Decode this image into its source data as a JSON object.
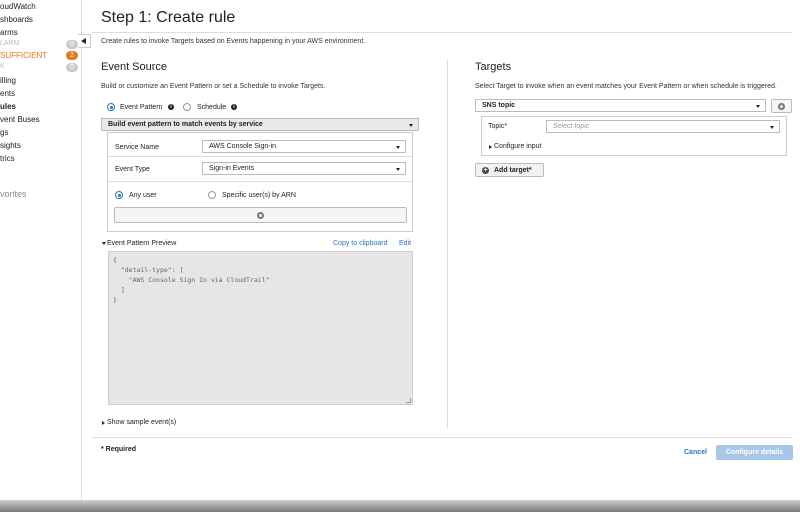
{
  "sidebar": {
    "items": [
      {
        "label": "oudWatch",
        "style": "normal"
      },
      {
        "label": "shboards",
        "style": "normal"
      },
      {
        "label": "arms",
        "style": "normal"
      },
      {
        "label": "LARM",
        "style": "grey",
        "badge": "0"
      },
      {
        "label": "SUFFICIENT",
        "style": "orange",
        "badge": "2"
      },
      {
        "label": "K",
        "style": "grey",
        "badge": "0"
      },
      {
        "label": "illing",
        "style": "normal"
      },
      {
        "label": "ents",
        "style": "normal"
      },
      {
        "label": "ules",
        "style": "bold"
      },
      {
        "label": "vent Buses",
        "style": "normal"
      },
      {
        "label": "gs",
        "style": "normal"
      },
      {
        "label": "sights",
        "style": "normal"
      },
      {
        "label": "trics",
        "style": "normal"
      }
    ],
    "favorites": "vorites"
  },
  "page": {
    "title": "Step 1: Create rule",
    "subtitle": "Create rules to invoke Targets based on Events happening in your AWS environment."
  },
  "event_source": {
    "title": "Event Source",
    "description": "Build or customize an Event Pattern or set a Schedule to invoke Targets.",
    "radio_event_pattern": "Event Pattern",
    "radio_schedule": "Schedule",
    "info_glyph": "i",
    "selected_mode": "Event Pattern",
    "pattern_builder": "Build event pattern to match events by service",
    "service_name_label": "Service Name",
    "service_name_value": "AWS Console Sign-in",
    "event_type_label": "Event Type",
    "event_type_value": "Sign-in Events",
    "any_user": "Any user",
    "specific_user": "Specific user(s) by ARN",
    "selected_user": "Any user",
    "preview_label": "Event Pattern Preview",
    "copy_link": "Copy to clipboard",
    "edit_link": "Edit",
    "preview_code": "{\n  \"detail-type\": [\n    \"AWS Console Sign In via CloudTrail\"\n  ]\n}",
    "show_sample": "Show sample event(s)"
  },
  "targets": {
    "title": "Targets",
    "description": "Select Target to invoke when an event matches your Event Pattern or when schedule is triggered.",
    "target_type": "SNS topic",
    "topic_label": "Topic*",
    "topic_placeholder": "Select topic",
    "configure_input": "Configure input",
    "add_target": "Add target*"
  },
  "footer": {
    "required": "* Required",
    "cancel": "Cancel",
    "configure_details": "Configure details"
  },
  "colors": {
    "accent": "#2d73c4",
    "alarm_orange": "#e07a1f",
    "primary_disabled": "#a7c7e8"
  }
}
